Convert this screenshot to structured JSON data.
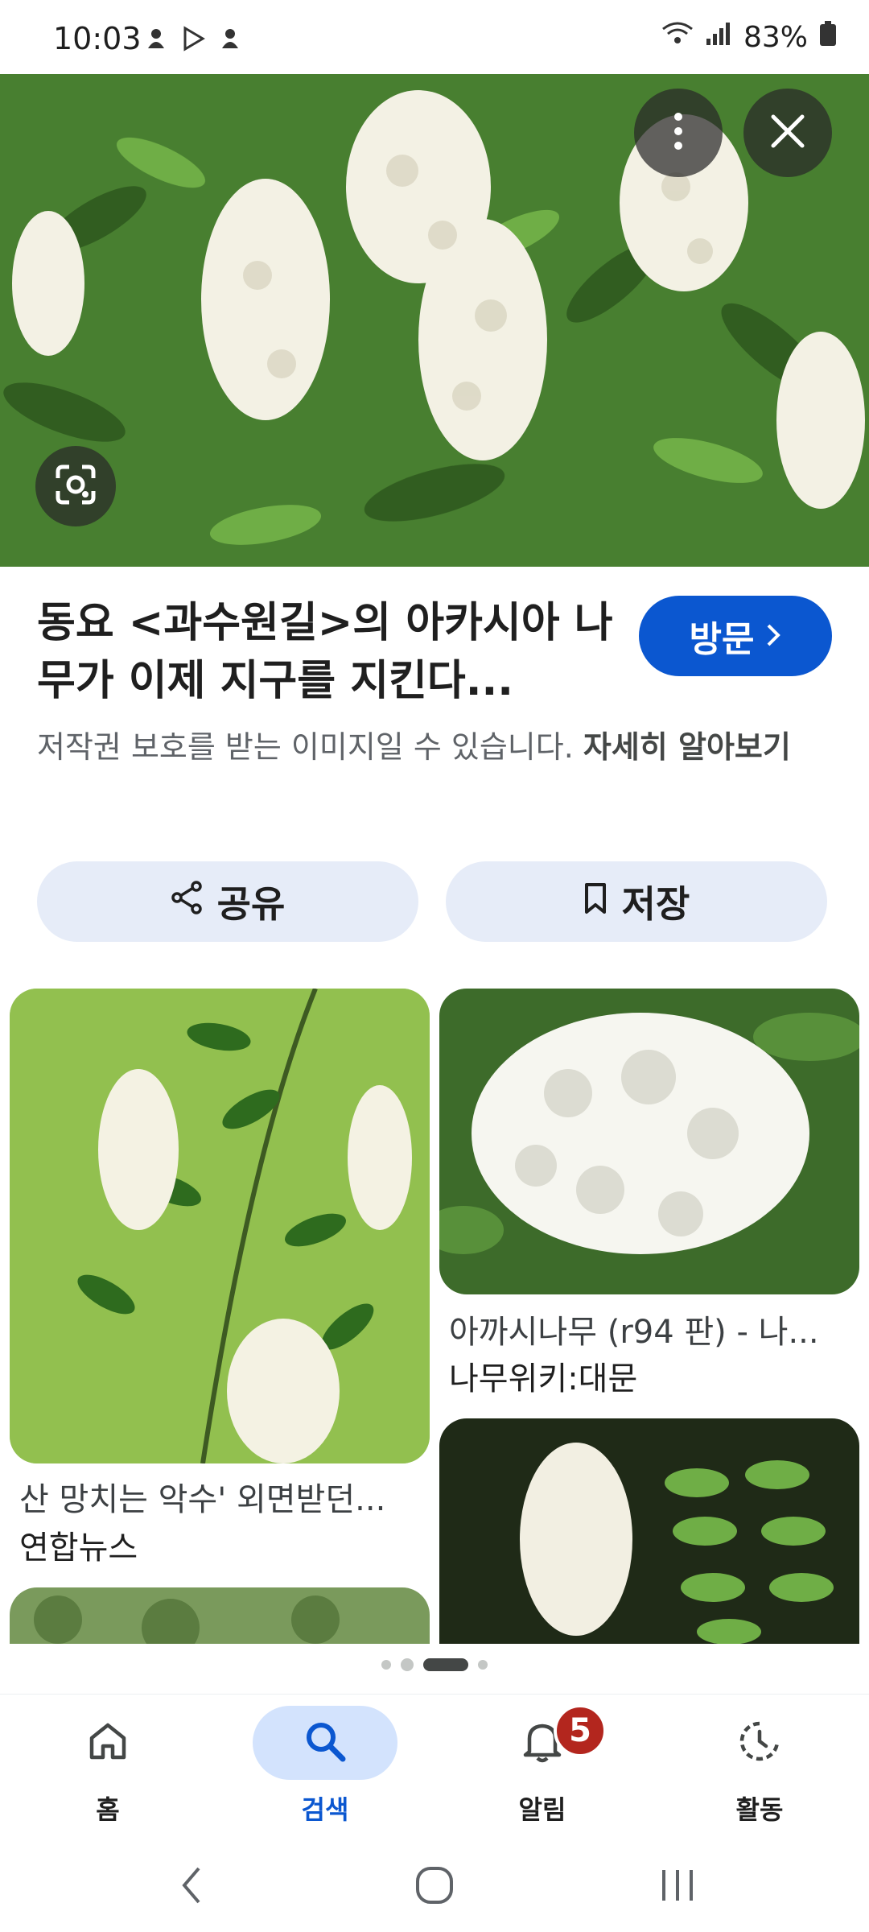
{
  "status_bar": {
    "time": "10:03",
    "battery": "83%",
    "left_icons": [
      "notification-icon",
      "play-store-icon",
      "notification-icon"
    ],
    "right_icons": [
      "wifi-icon",
      "signal-icon",
      "battery-icon"
    ]
  },
  "hero": {
    "menu_icon": "more-vertical-icon",
    "close_icon": "close-icon",
    "lens_icon": "google-lens-icon"
  },
  "result": {
    "title": "동요 <과수원길>의 아카시아 나무가 이제 지구를 지킨다...",
    "visit_label": "방문",
    "copyright_text": "저작권 보호를 받는 이미지일 수 있습니다.",
    "learn_more": "자세히 알아보기"
  },
  "actions": {
    "share_label": "공유",
    "save_label": "저장"
  },
  "related": [
    {
      "title": "산 망치는 악수' 외면받던...",
      "source": "연합뉴스"
    },
    {
      "title": "아까시나무 (r94 판) - 나...",
      "source": "나무위키:대문"
    }
  ],
  "bottom_nav": {
    "items": [
      {
        "label": "홈",
        "icon": "home-icon"
      },
      {
        "label": "검색",
        "icon": "search-icon"
      },
      {
        "label": "알림",
        "icon": "bell-icon",
        "badge": "5"
      },
      {
        "label": "활동",
        "icon": "activity-icon"
      }
    ],
    "active_index": 1
  },
  "colors": {
    "accent": "#0b57d0",
    "chip_bg": "#e6ecf8",
    "badge": "#b3261e",
    "active_nav_bg": "#d3e3fd"
  }
}
